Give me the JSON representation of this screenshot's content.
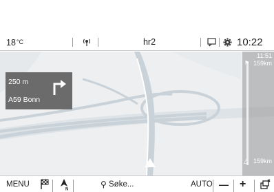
{
  "status_bar": {
    "temperature": "18",
    "temperature_unit": "°C",
    "source": "hr2",
    "time": "10:22",
    "icons": [
      "radio-icon",
      "phone-icon",
      "gear-icon"
    ]
  },
  "guidance": {
    "distance": "250 m",
    "road": "A59 Bonn",
    "maneuver": "turn-right-icon"
  },
  "route": {
    "eta": "11:51",
    "eta_distance": "159km",
    "remaining_distance": "159km"
  },
  "bottom_bar": {
    "menu_label": "MENU",
    "search_placeholder": "Søke...",
    "auto_label": "AUTO",
    "zoom_out": "—",
    "zoom_in": "+",
    "north_label": "N",
    "icons": [
      "destination-flag-icon",
      "north-up-icon",
      "search-icon",
      "zoom-out-icon",
      "zoom-in-icon",
      "layers-icon"
    ]
  },
  "colors": {
    "map_background": "#eeeff1",
    "road_fill": "#c8d2d8",
    "guidance_box": "#6b6b6b",
    "route_bar": "#969696"
  }
}
